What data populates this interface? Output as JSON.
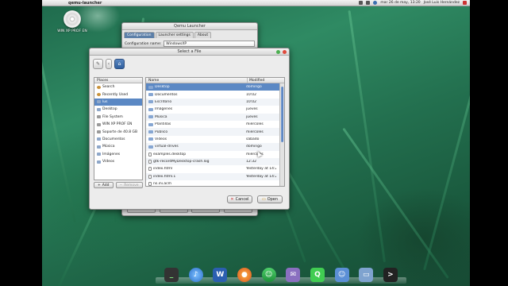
{
  "panel": {
    "app_title": "qemu-launcher",
    "datetime": "mar 26 de may, 13:20",
    "user": "José Luis Hernández"
  },
  "desktop_icon": {
    "label": "WIN XP PROF EN"
  },
  "qemu_window": {
    "title": "Qemu Launcher",
    "tabs": [
      "Configuration",
      "Launcher settings",
      "About"
    ],
    "config_label": "Configuration name:",
    "config_value": "WindowsXP"
  },
  "file_dialog": {
    "title": "Select a File",
    "places_header": "Places",
    "places": [
      {
        "label": "Search",
        "icon": "search-icon"
      },
      {
        "label": "Recently Used",
        "icon": "clock-icon"
      },
      {
        "label": "lus",
        "icon": "home-folder-icon"
      },
      {
        "label": "Desktop",
        "icon": "desktop-icon"
      },
      {
        "label": "File System",
        "icon": "drive-icon"
      },
      {
        "label": "WIN XP PROF EN",
        "icon": "cd-icon"
      },
      {
        "label": "Soporte de 40.8 GB",
        "icon": "drive-icon"
      },
      {
        "label": "Documentos",
        "icon": "folder-icon"
      },
      {
        "label": "Música",
        "icon": "folder-icon"
      },
      {
        "label": "Imágenes",
        "icon": "folder-icon"
      },
      {
        "label": "Vídeos",
        "icon": "folder-icon"
      }
    ],
    "columns": {
      "name": "Name",
      "modified": "Modified"
    },
    "files": [
      {
        "name": "Desktop",
        "modified": "domingo",
        "type": "folder"
      },
      {
        "name": "Documentos",
        "modified": "10:02",
        "type": "folder"
      },
      {
        "name": "Escritorio",
        "modified": "10:02",
        "type": "folder"
      },
      {
        "name": "Imágenes",
        "modified": "jueves",
        "type": "folder"
      },
      {
        "name": "Música",
        "modified": "jueves",
        "type": "folder"
      },
      {
        "name": "Plantillas",
        "modified": "miércoles",
        "type": "folder"
      },
      {
        "name": "Público",
        "modified": "miércoles",
        "type": "folder"
      },
      {
        "name": "Vídeos",
        "modified": "sábado",
        "type": "folder"
      },
      {
        "name": "virtual-drives",
        "modified": "domingo",
        "type": "folder"
      },
      {
        "name": "examples.desktop",
        "modified": "miércoles",
        "type": "file"
      },
      {
        "name": "gtk-recordMyDesktop-crash.log",
        "modified": "12:32",
        "type": "file"
      },
      {
        "name": "index.html",
        "modified": "Yesterday at 14:26",
        "type": "file"
      },
      {
        "name": "index.html.1",
        "modified": "Yesterday at 14:26",
        "type": "file"
      },
      {
        "name": "ns.ini.acm",
        "modified": "",
        "type": "file"
      }
    ],
    "add_label": "Add",
    "remove_label": "Remove",
    "cancel_label": "Cancel",
    "open_label": "Open"
  },
  "dock": [
    "terminal",
    "itunes",
    "word",
    "firefox",
    "messenger",
    "pidgin",
    "qt",
    "finder",
    "folder",
    "terminal-2"
  ],
  "colors": {
    "selection": "#5b88c4",
    "accent": "#2f5f9e"
  }
}
